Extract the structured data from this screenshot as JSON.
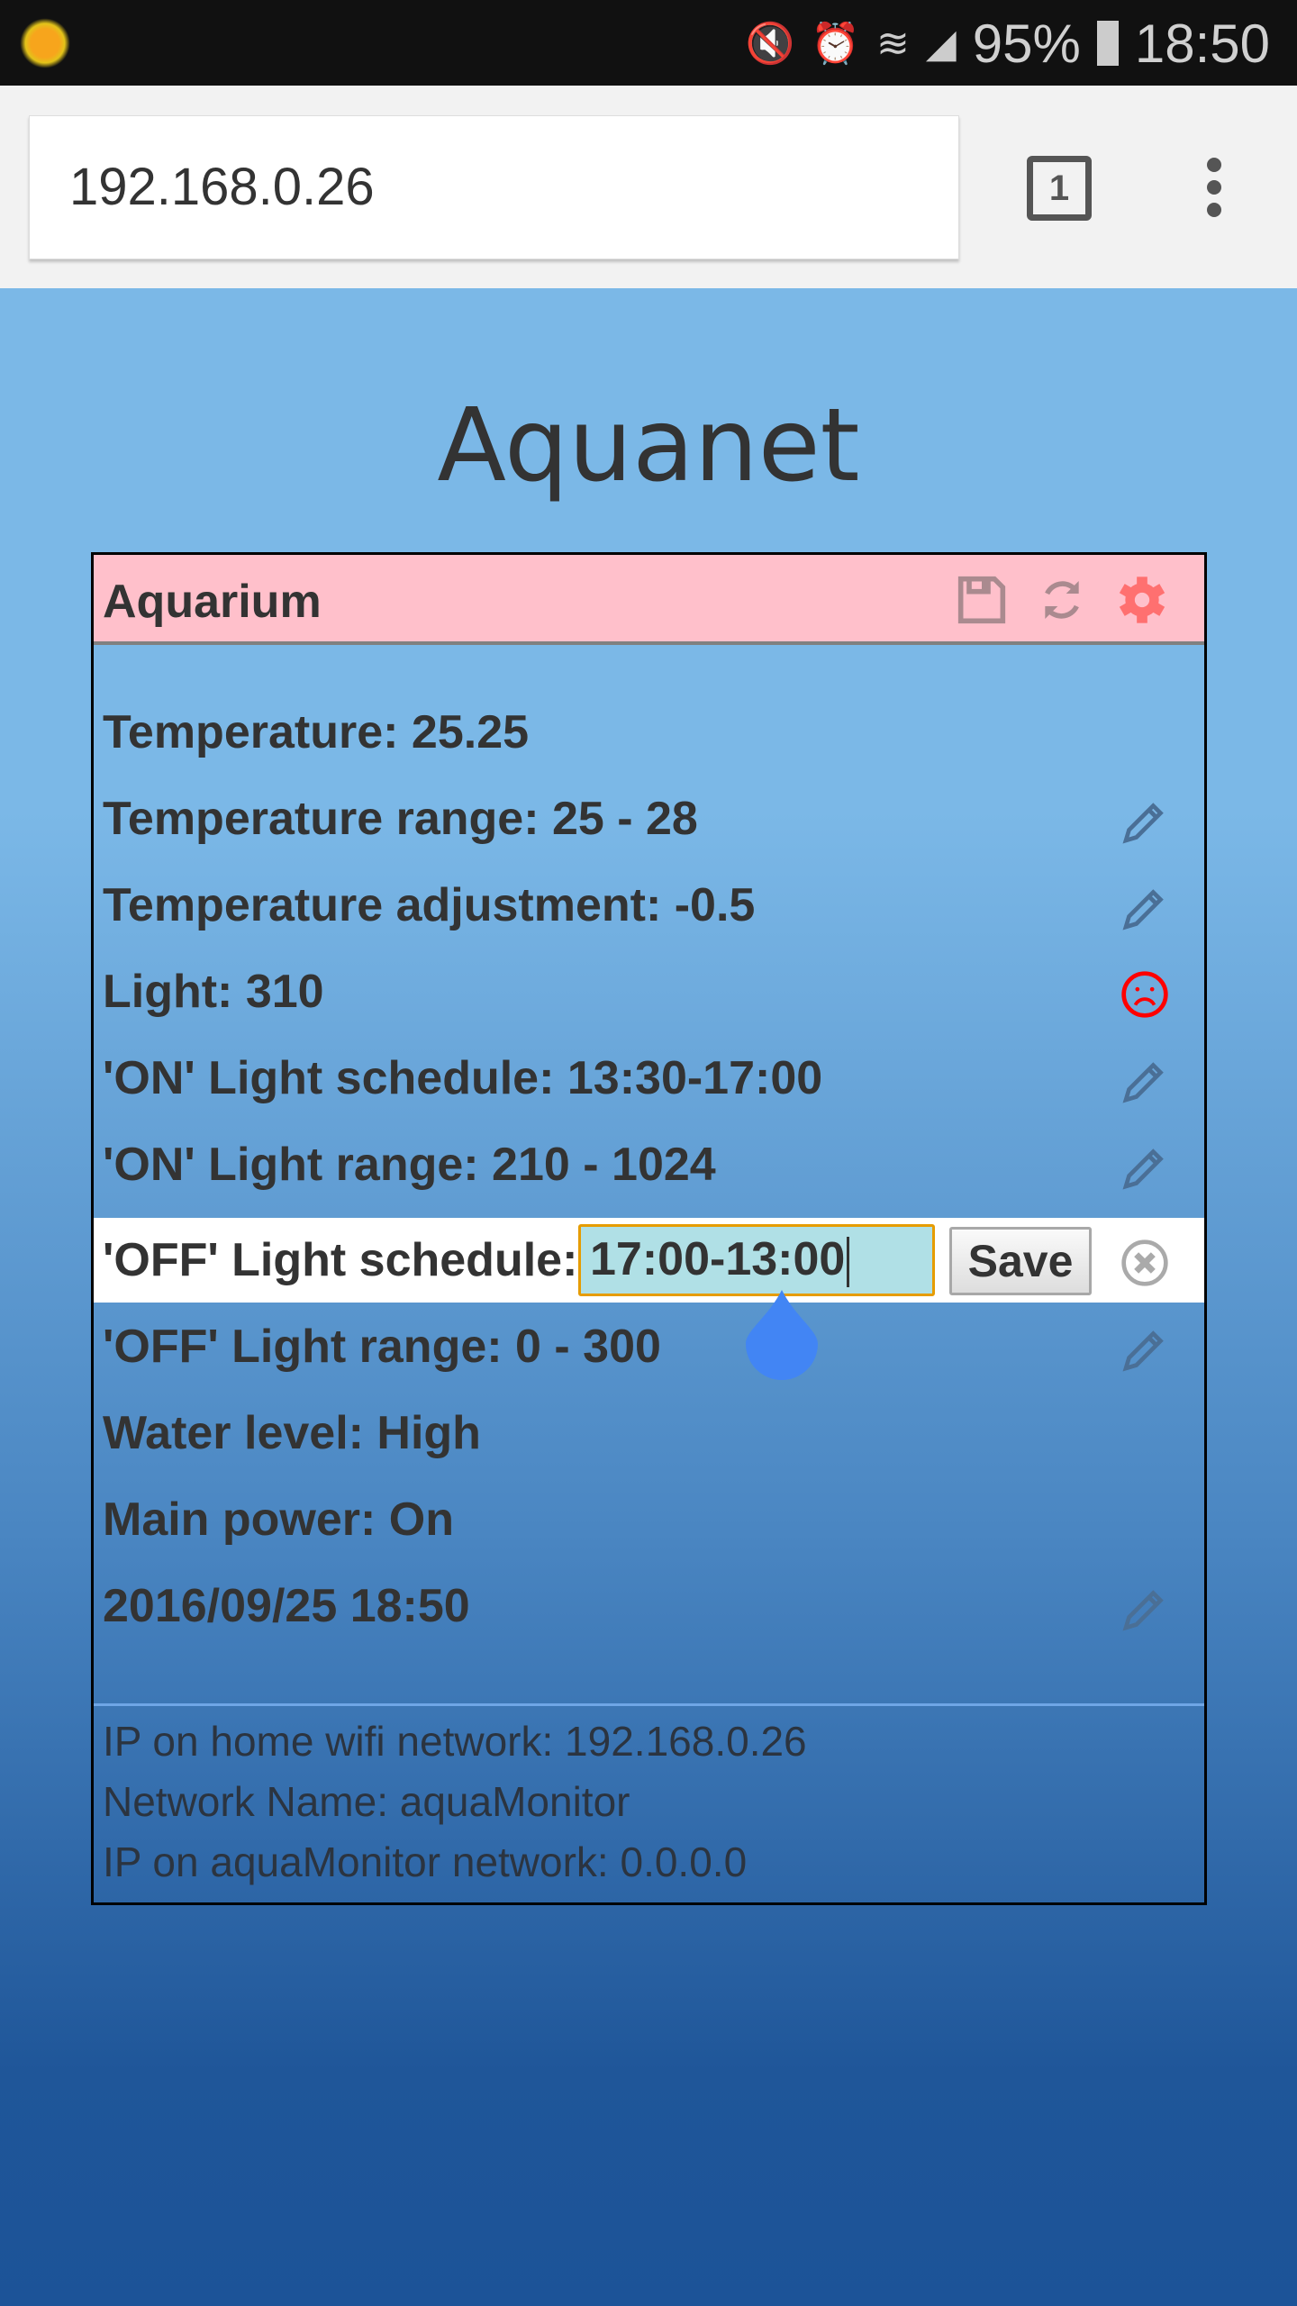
{
  "status_bar": {
    "battery": "95%",
    "time": "18:50",
    "icons": [
      "weather-sun-icon",
      "mute-vibrate-icon",
      "alarm-icon",
      "wifi-icon",
      "signal-icon",
      "battery-icon"
    ]
  },
  "browser": {
    "url": "192.168.0.26",
    "tab_count": "1"
  },
  "page": {
    "title": "Aquanet"
  },
  "card": {
    "title": "Aquarium",
    "rows": [
      {
        "label": "Temperature: 25.25",
        "icon": ""
      },
      {
        "label": "Temperature range: 25 - 28",
        "icon": "pencil"
      },
      {
        "label": "Temperature adjustment: -0.5",
        "icon": "pencil"
      },
      {
        "label": "Light: 310",
        "icon": "sad"
      },
      {
        "label": "'ON' Light schedule: 13:30-17:00",
        "icon": "pencil"
      },
      {
        "label": "'ON' Light range: 210 - 1024",
        "icon": "pencil"
      }
    ],
    "edit_row": {
      "label": "'OFF' Light schedule:",
      "value": "17:00-13:00",
      "save": "Save"
    },
    "rows2": [
      {
        "label": "'OFF' Light range: 0 - 300",
        "icon": "pencil"
      },
      {
        "label": "Water level: High",
        "icon": ""
      },
      {
        "label": "Main power: On",
        "icon": ""
      },
      {
        "label": "2016/09/25 18:50",
        "icon": "pencil"
      }
    ],
    "footer": [
      "IP on home wifi network: 192.168.0.26",
      "Network Name: aquaMonitor",
      "IP on aquaMonitor network: 0.0.0.0"
    ]
  },
  "colors": {
    "header": "#ffc0cb",
    "gear": "#ff7070",
    "sad": "#ff0000",
    "input_border": "#e69c00",
    "input_bg": "#b0e0e6"
  }
}
